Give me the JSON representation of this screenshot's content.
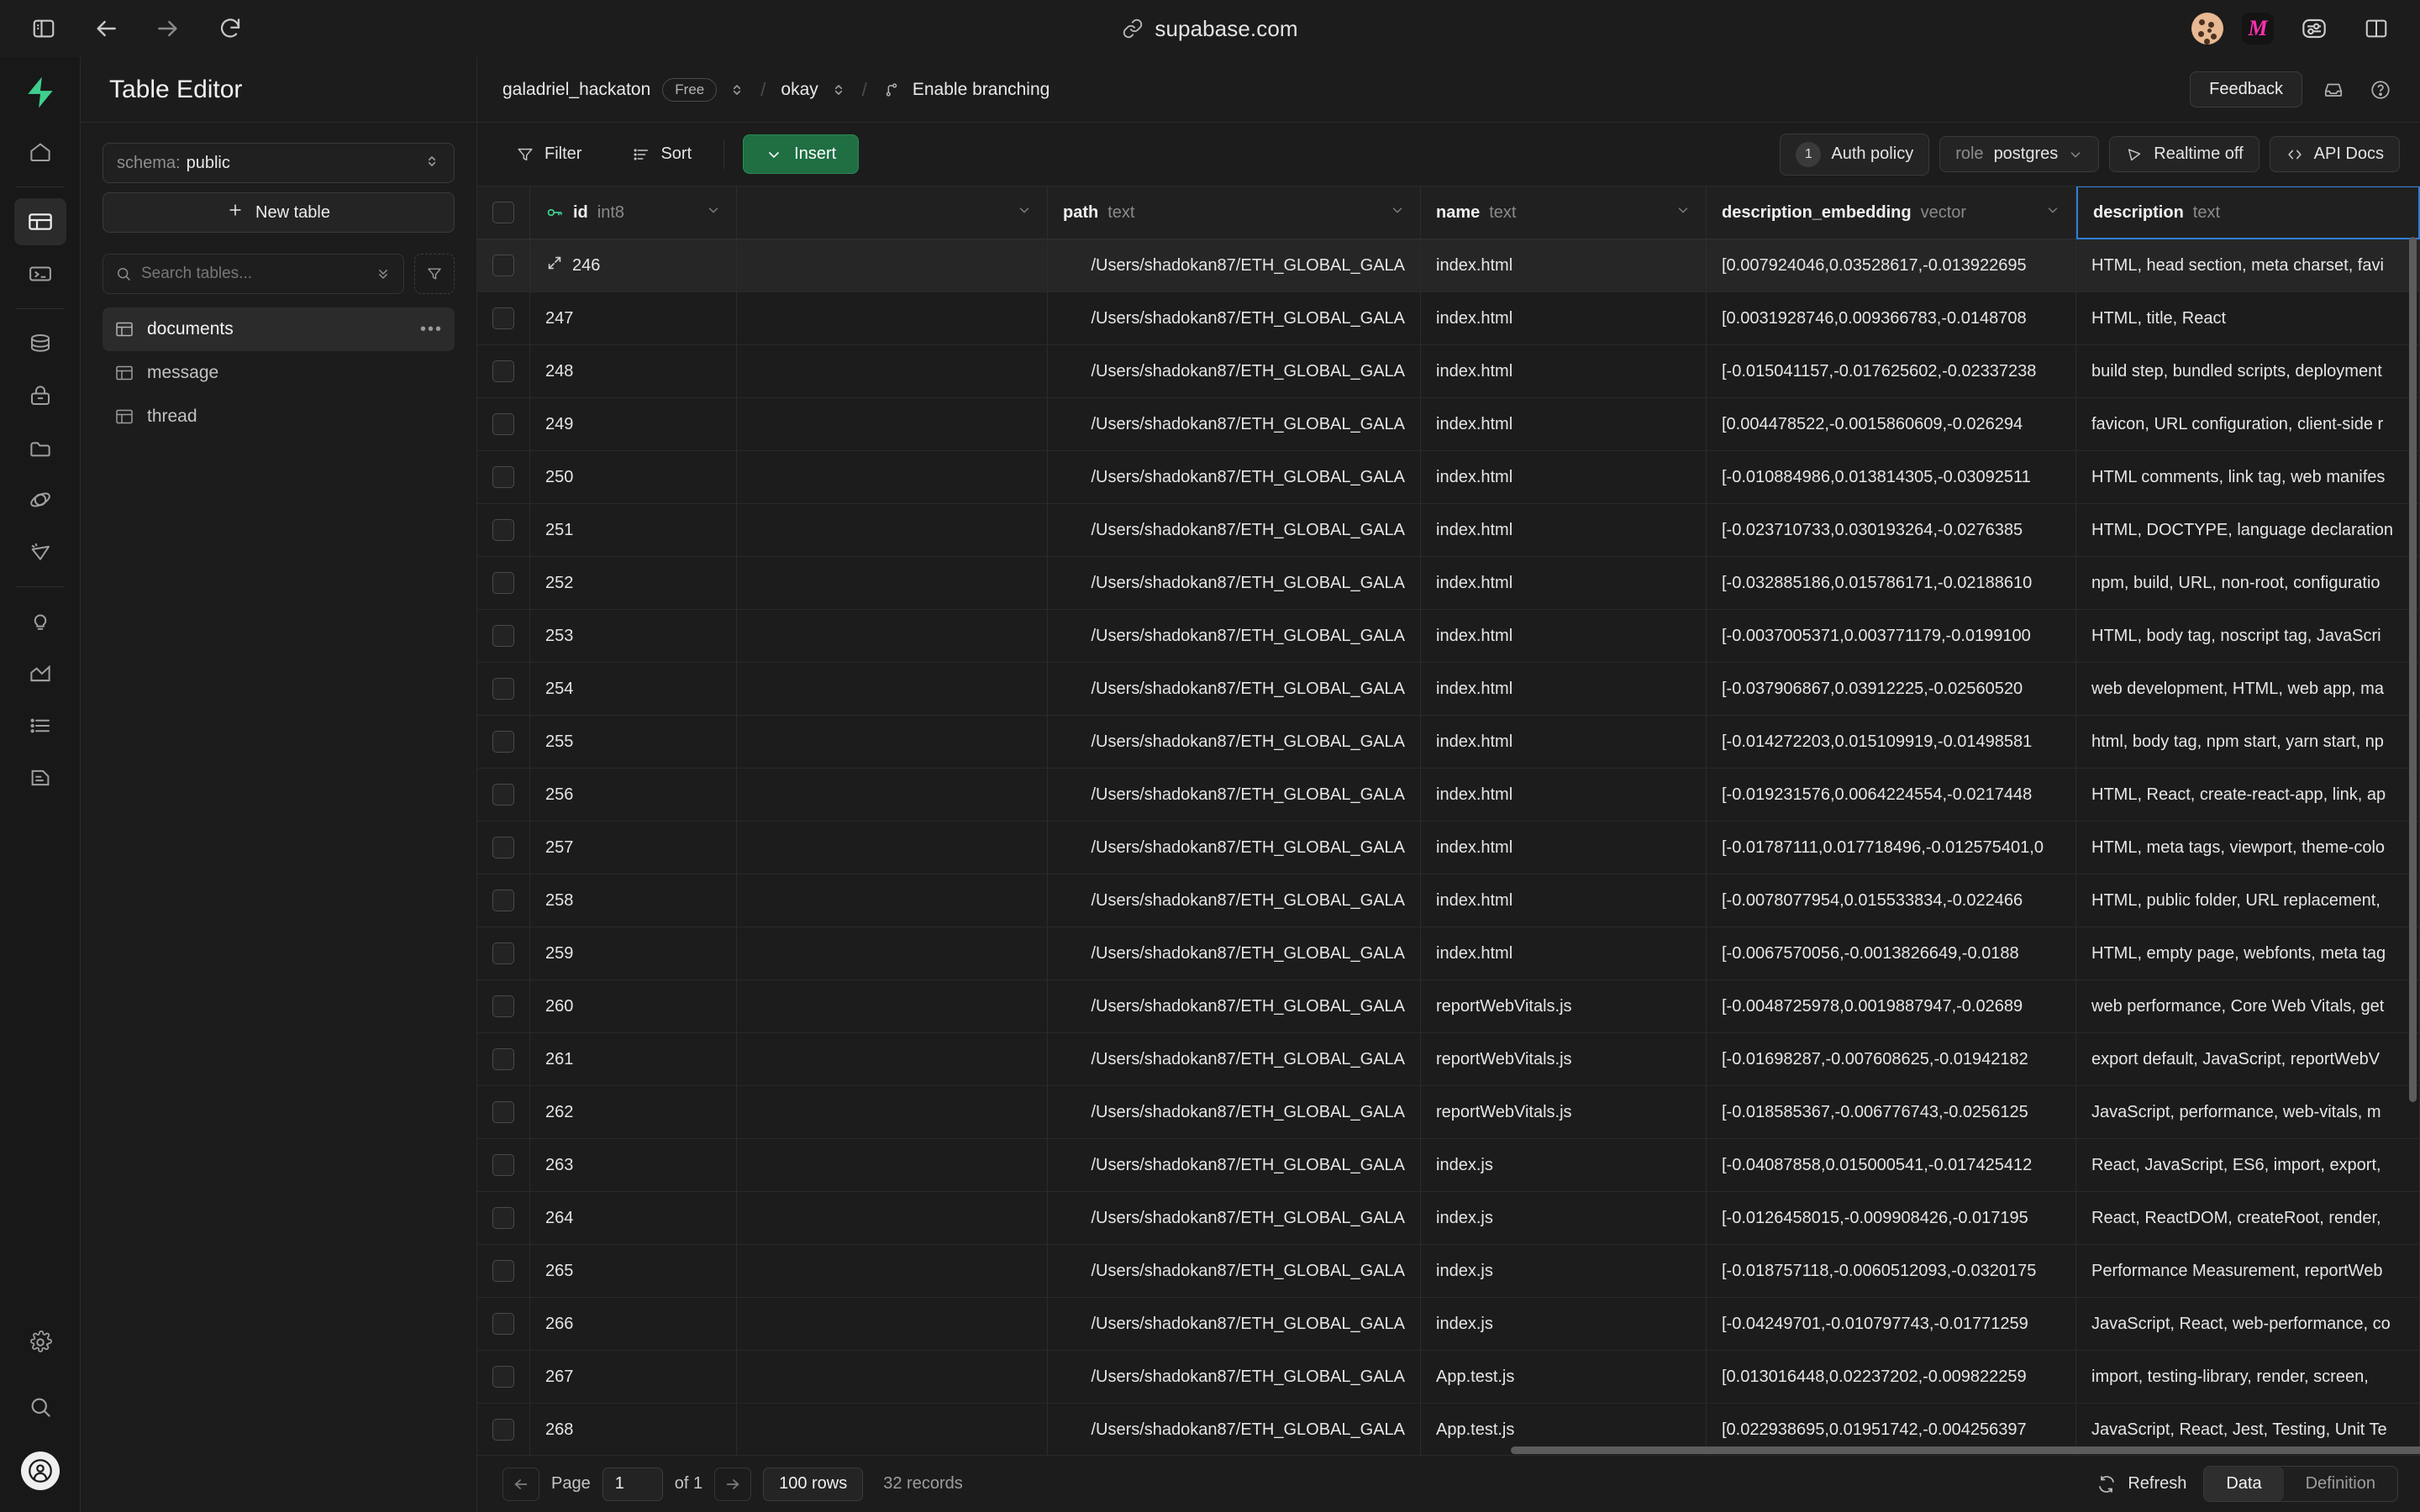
{
  "browser": {
    "url": "supabase.com",
    "nav": {
      "sidebar_toggle": "sidebar-toggle-icon",
      "back": "back-arrow-icon",
      "forward": "forward-arrow-icon",
      "reload": "reload-icon"
    },
    "extensions": [
      {
        "name": "cookie-extension-icon",
        "label": ""
      },
      {
        "name": "m-extension-icon",
        "label": "M"
      },
      {
        "name": "sliders-extension-icon",
        "label": ""
      },
      {
        "name": "split-view-icon",
        "label": ""
      }
    ]
  },
  "rail": {
    "logo": "supabase-logo",
    "items": [
      {
        "name": "home",
        "active": false
      },
      {
        "name": "table-editor",
        "active": true
      },
      {
        "name": "sql-editor",
        "active": false
      },
      {
        "name": "database",
        "active": false
      },
      {
        "name": "auth",
        "active": false
      },
      {
        "name": "storage",
        "active": false
      },
      {
        "name": "edge-functions",
        "active": false
      },
      {
        "name": "realtime",
        "active": false
      },
      {
        "name": "advisors",
        "active": false
      },
      {
        "name": "reports",
        "active": false
      },
      {
        "name": "logs",
        "active": false
      },
      {
        "name": "api-docs",
        "active": false
      }
    ],
    "bottom": [
      {
        "name": "settings"
      },
      {
        "name": "search"
      },
      {
        "name": "user-avatar"
      }
    ]
  },
  "table_panel": {
    "title": "Table Editor",
    "schema_label": "schema:",
    "schema_value": "public",
    "new_table_label": "New table",
    "search_placeholder": "Search tables...",
    "search_value": "",
    "tables": [
      {
        "label": "documents",
        "active": true
      },
      {
        "label": "message",
        "active": false
      },
      {
        "label": "thread",
        "active": false
      }
    ]
  },
  "breadcrumb": {
    "project": "galadriel_hackaton",
    "plan_badge": "Free",
    "separator": "/",
    "branch": "okay",
    "enable_branching": "Enable branching",
    "feedback_label": "Feedback"
  },
  "toolbar": {
    "filter_label": "Filter",
    "sort_label": "Sort",
    "insert_label": "Insert",
    "auth_policy_count": "1",
    "auth_policy_label": "Auth policy",
    "role_label": "role",
    "role_value": "postgres",
    "realtime_label": "Realtime off",
    "api_docs_label": "API Docs"
  },
  "grid": {
    "columns": [
      {
        "key": "check",
        "label": "",
        "type": ""
      },
      {
        "key": "id",
        "label": "id",
        "type": "int8",
        "primary": true
      },
      {
        "key": "blank",
        "label": "",
        "type": ""
      },
      {
        "key": "path",
        "label": "path",
        "type": "text"
      },
      {
        "key": "name",
        "label": "name",
        "type": "text"
      },
      {
        "key": "embedding",
        "label": "description_embedding",
        "type": "vector"
      },
      {
        "key": "description",
        "label": "description",
        "type": "text",
        "selected": true
      }
    ],
    "rows": [
      {
        "id": "246",
        "blank": "",
        "path": "/Users/shadokan87/ETH_GLOBAL_GALA",
        "name": "index.html",
        "embedding": "[0.007924046,0.03528617,-0.013922695",
        "description": "HTML, head section, meta charset, favi",
        "hover": true
      },
      {
        "id": "247",
        "blank": "",
        "path": "/Users/shadokan87/ETH_GLOBAL_GALA",
        "name": "index.html",
        "embedding": "[0.0031928746,0.009366783,-0.0148708",
        "description": "HTML, title, React"
      },
      {
        "id": "248",
        "blank": "",
        "path": "/Users/shadokan87/ETH_GLOBAL_GALA",
        "name": "index.html",
        "embedding": "[-0.015041157,-0.017625602,-0.02337238",
        "description": "build step, bundled scripts, deployment"
      },
      {
        "id": "249",
        "blank": "",
        "path": "/Users/shadokan87/ETH_GLOBAL_GALA",
        "name": "index.html",
        "embedding": "[0.004478522,-0.0015860609,-0.026294",
        "description": "favicon, URL configuration, client-side r"
      },
      {
        "id": "250",
        "blank": "",
        "path": "/Users/shadokan87/ETH_GLOBAL_GALA",
        "name": "index.html",
        "embedding": "[-0.010884986,0.013814305,-0.03092511",
        "description": "HTML comments, link tag, web manifes"
      },
      {
        "id": "251",
        "blank": "",
        "path": "/Users/shadokan87/ETH_GLOBAL_GALA",
        "name": "index.html",
        "embedding": "[-0.023710733,0.030193264,-0.0276385",
        "description": "HTML, DOCTYPE, language declaration"
      },
      {
        "id": "252",
        "blank": "",
        "path": "/Users/shadokan87/ETH_GLOBAL_GALA",
        "name": "index.html",
        "embedding": "[-0.032885186,0.015786171,-0.02188610",
        "description": "npm, build, URL, non-root, configuratio"
      },
      {
        "id": "253",
        "blank": "",
        "path": "/Users/shadokan87/ETH_GLOBAL_GALA",
        "name": "index.html",
        "embedding": "[-0.0037005371,0.003771179,-0.0199100",
        "description": "HTML, body tag, noscript tag, JavaScri"
      },
      {
        "id": "254",
        "blank": "",
        "path": "/Users/shadokan87/ETH_GLOBAL_GALA",
        "name": "index.html",
        "embedding": "[-0.037906867,0.03912225,-0.02560520",
        "description": "web development, HTML, web app, ma"
      },
      {
        "id": "255",
        "blank": "",
        "path": "/Users/shadokan87/ETH_GLOBAL_GALA",
        "name": "index.html",
        "embedding": "[-0.014272203,0.015109919,-0.01498581",
        "description": "html, body tag, npm start, yarn start, np"
      },
      {
        "id": "256",
        "blank": "",
        "path": "/Users/shadokan87/ETH_GLOBAL_GALA",
        "name": "index.html",
        "embedding": "[-0.019231576,0.0064224554,-0.0217448",
        "description": "HTML, React, create-react-app, link, ap"
      },
      {
        "id": "257",
        "blank": "",
        "path": "/Users/shadokan87/ETH_GLOBAL_GALA",
        "name": "index.html",
        "embedding": "[-0.01787111,0.017718496,-0.012575401,0",
        "description": "HTML, meta tags, viewport, theme-colo"
      },
      {
        "id": "258",
        "blank": "",
        "path": "/Users/shadokan87/ETH_GLOBAL_GALA",
        "name": "index.html",
        "embedding": "[-0.0078077954,0.015533834,-0.022466",
        "description": "HTML, public folder, URL replacement,"
      },
      {
        "id": "259",
        "blank": "",
        "path": "/Users/shadokan87/ETH_GLOBAL_GALA",
        "name": "index.html",
        "embedding": "[-0.0067570056,-0.0013826649,-0.0188",
        "description": "HTML, empty page, webfonts, meta tag"
      },
      {
        "id": "260",
        "blank": "",
        "path": "/Users/shadokan87/ETH_GLOBAL_GALA",
        "name": "reportWebVitals.js",
        "embedding": "[-0.0048725978,0.0019887947,-0.02689",
        "description": "web performance, Core Web Vitals, get"
      },
      {
        "id": "261",
        "blank": "",
        "path": "/Users/shadokan87/ETH_GLOBAL_GALA",
        "name": "reportWebVitals.js",
        "embedding": "[-0.01698287,-0.007608625,-0.01942182",
        "description": "export default, JavaScript, reportWebV"
      },
      {
        "id": "262",
        "blank": "",
        "path": "/Users/shadokan87/ETH_GLOBAL_GALA",
        "name": "reportWebVitals.js",
        "embedding": "[-0.018585367,-0.006776743,-0.0256125",
        "description": "JavaScript, performance, web-vitals, m"
      },
      {
        "id": "263",
        "blank": "",
        "path": "/Users/shadokan87/ETH_GLOBAL_GALA",
        "name": "index.js",
        "embedding": "[-0.04087858,0.015000541,-0.017425412",
        "description": "React, JavaScript, ES6, import, export,"
      },
      {
        "id": "264",
        "blank": "",
        "path": "/Users/shadokan87/ETH_GLOBAL_GALA",
        "name": "index.js",
        "embedding": "[-0.0126458015,-0.009908426,-0.017195",
        "description": "React, ReactDOM, createRoot, render,"
      },
      {
        "id": "265",
        "blank": "",
        "path": "/Users/shadokan87/ETH_GLOBAL_GALA",
        "name": "index.js",
        "embedding": "[-0.018757118,-0.0060512093,-0.0320175",
        "description": "Performance Measurement, reportWeb"
      },
      {
        "id": "266",
        "blank": "",
        "path": "/Users/shadokan87/ETH_GLOBAL_GALA",
        "name": "index.js",
        "embedding": "[-0.04249701,-0.010797743,-0.01771259",
        "description": "JavaScript, React, web-performance, co"
      },
      {
        "id": "267",
        "blank": "",
        "path": "/Users/shadokan87/ETH_GLOBAL_GALA",
        "name": "App.test.js",
        "embedding": "[0.013016448,0.02237202,-0.009822259",
        "description": "import, testing-library, render, screen,"
      },
      {
        "id": "268",
        "blank": "",
        "path": "/Users/shadokan87/ETH_GLOBAL_GALA",
        "name": "App.test.js",
        "embedding": "[0.022938695,0.01951742,-0.004256397",
        "description": "JavaScript, React, Jest, Testing, Unit Te"
      }
    ]
  },
  "footer": {
    "page_label": "Page",
    "page_value": "1",
    "of_label": "of 1",
    "rows_label": "100 rows",
    "records_label": "32 records",
    "refresh_label": "Refresh",
    "tabs": [
      {
        "label": "Data",
        "active": true
      },
      {
        "label": "Definition",
        "active": false
      }
    ]
  }
}
